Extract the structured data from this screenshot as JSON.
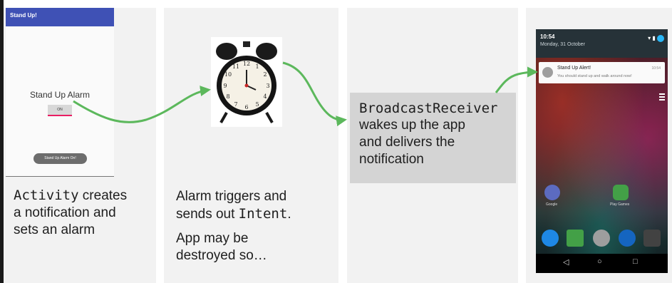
{
  "panel1": {
    "app_title": "Stand Up!",
    "alarm_label": "Stand Up Alarm",
    "toggle_label": "ON",
    "button_label": "Stand Up Alarm On!",
    "caption_code": "Activity",
    "caption_rest1": " creates",
    "caption_line2": "a notification and",
    "caption_line3": "sets an alarm"
  },
  "panel2": {
    "caption_line1": "Alarm triggers and",
    "caption_line2_prefix": "sends out ",
    "caption_code": "Intent",
    "caption_line2_suffix": ".",
    "caption2_line1": "App may be",
    "caption2_line2": "destroyed so…"
  },
  "panel3": {
    "code": "BroadcastReceiver",
    "line2": "wakes up the app",
    "line3": "and delivers the",
    "line4": "notification"
  },
  "panel4": {
    "time": "10:54",
    "date": "Monday, 31 October",
    "notif_title": "Stand Up Alert!",
    "notif_time": "10:54",
    "notif_body": "You should stand up and walk around now!",
    "app1_label": "Google",
    "app2_label": "Play Games"
  },
  "colors": {
    "arrow": "#5cb85c",
    "appbar": "#3f51b5",
    "panel": "#f2f2f2",
    "box": "#d4d4d4"
  },
  "icons": [
    "clock-icon",
    "arrow-icon",
    "notification-icon",
    "menu-icon",
    "back-icon",
    "home-icon",
    "recents-icon"
  ]
}
